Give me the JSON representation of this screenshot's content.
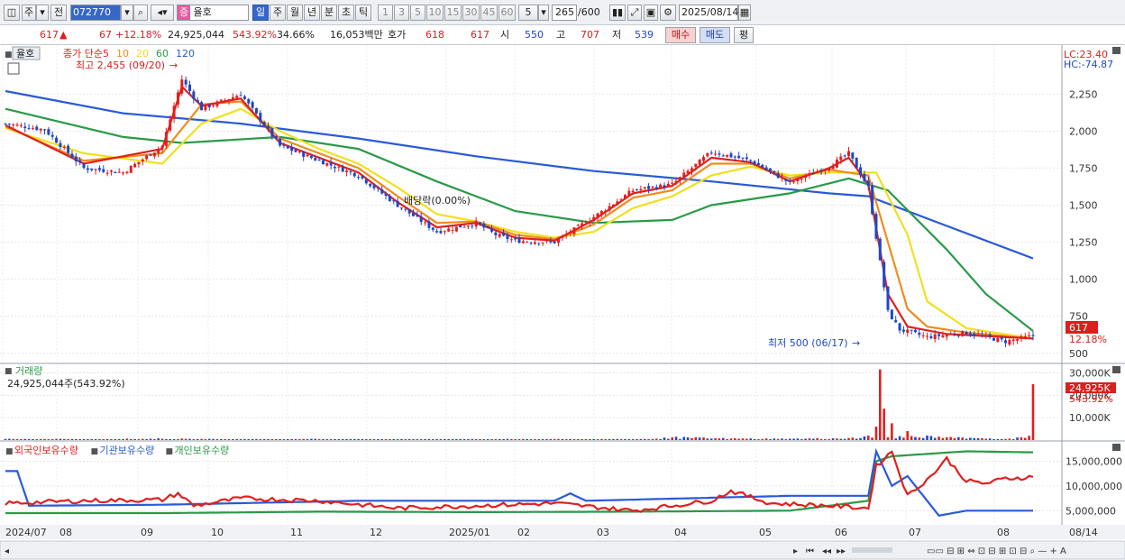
{
  "toolbar": {
    "prev_label": "주",
    "jeon_label": "전",
    "code_value": "072770",
    "name_badge": "증",
    "name_value": "율호",
    "periods": [
      "일",
      "주",
      "월",
      "년",
      "분",
      "초",
      "틱"
    ],
    "active_period": "일",
    "numbers": [
      "1",
      "3",
      "5",
      "10",
      "15",
      "30",
      "45",
      "60"
    ],
    "count_select": "5",
    "range_value": "265",
    "range_total": "/600",
    "date_value": "2025/08/14"
  },
  "quote": {
    "price": "617",
    "change_arrow": "▲",
    "change": "67",
    "change_pct": "+12.18%",
    "volume": "24,925,044",
    "volume_ratio": "543.92%",
    "turnover": "34.66%",
    "amount": "16,053백만",
    "hoga_label": "호가",
    "ask": "618",
    "bid": "617",
    "open_label": "시",
    "open": "550",
    "high_label": "고",
    "high": "707",
    "low_label": "저",
    "low": "539",
    "buy_label": "매수",
    "sell_label": "매도",
    "eval_label": "평"
  },
  "price_panel": {
    "name_tag": "율호",
    "legend_prefix": "종가 단순",
    "ma_periods": [
      "5",
      "10",
      "20",
      "60",
      "120"
    ],
    "ma_colors": [
      "#e0201e",
      "#f08c1e",
      "#f0e020",
      "#2a9a48",
      "#2a5ad8"
    ],
    "max_note": "최고 2,455 (09/20)",
    "min_note": "최저 500 (06/17)",
    "dividend_note": "배당락(0.00%)",
    "lc_label": "LC:23.40",
    "hc_label": "HC:-74.87",
    "last_price_tag": "617",
    "last_change_tag": "12.18%"
  },
  "volume_panel": {
    "title": "거래량",
    "value_text": "24,925,044주(543.92%)",
    "tag_value": "24,925K",
    "tag_pct": "543.92%"
  },
  "holding_panel": {
    "legend": [
      "외국인보유수량",
      "기관보유수량",
      "개인보유수량"
    ],
    "legend_colors": [
      "#e0201e",
      "#2a5ad8",
      "#2a9a48"
    ]
  },
  "chart_data": [
    {
      "type": "candlestick",
      "title": "",
      "x": [
        "2024/07",
        "08",
        "09",
        "10",
        "11",
        "12",
        "2025/01",
        "02",
        "03",
        "04",
        "05",
        "06",
        "07",
        "08"
      ],
      "y_ticks": [
        500,
        750,
        1000,
        1250,
        1500,
        1750,
        2000,
        2250
      ],
      "y_tick_labels": [
        "500",
        "750",
        "1,000",
        "1,250",
        "1,500",
        "1,750",
        "2,000",
        "2,250"
      ],
      "ylim": [
        450,
        2550
      ],
      "series": [
        {
          "name": "종가",
          "x": [
            0,
            10,
            20,
            30,
            40,
            45,
            50,
            60,
            70,
            80,
            90,
            100,
            110,
            120,
            125,
            130,
            140,
            150,
            160,
            170,
            180,
            190,
            200,
            210,
            215,
            220,
            225,
            228,
            235,
            245,
            255,
            262
          ],
          "values": [
            2050,
            2010,
            1750,
            1720,
            1900,
            2350,
            2150,
            2250,
            1900,
            1800,
            1700,
            1500,
            1320,
            1380,
            1300,
            1260,
            1250,
            1420,
            1600,
            1640,
            1860,
            1800,
            1650,
            1760,
            1850,
            1620,
            780,
            660,
            610,
            640,
            580,
            617
          ]
        },
        {
          "name": "5",
          "x": [
            0,
            20,
            40,
            45,
            50,
            60,
            70,
            80,
            90,
            100,
            110,
            120,
            130,
            140,
            150,
            160,
            170,
            180,
            190,
            200,
            210,
            215,
            220,
            225,
            230,
            240,
            262
          ],
          "values": [
            2040,
            1780,
            1880,
            2300,
            2170,
            2220,
            1920,
            1820,
            1720,
            1520,
            1350,
            1380,
            1280,
            1260,
            1400,
            1580,
            1630,
            1820,
            1790,
            1660,
            1750,
            1820,
            1640,
            900,
            680,
            630,
            600
          ]
        },
        {
          "name": "10",
          "x": [
            0,
            20,
            40,
            50,
            60,
            70,
            80,
            90,
            100,
            110,
            120,
            130,
            140,
            150,
            160,
            170,
            180,
            190,
            200,
            210,
            220,
            225,
            230,
            235,
            245,
            262
          ],
          "values": [
            2030,
            1800,
            1850,
            2180,
            2200,
            1950,
            1850,
            1750,
            1560,
            1380,
            1390,
            1300,
            1270,
            1370,
            1550,
            1600,
            1780,
            1780,
            1680,
            1740,
            1700,
            1250,
            800,
            680,
            640,
            600
          ]
        },
        {
          "name": "20",
          "x": [
            0,
            20,
            40,
            50,
            60,
            70,
            80,
            90,
            100,
            110,
            120,
            130,
            140,
            150,
            160,
            170,
            180,
            190,
            200,
            210,
            222,
            230,
            235,
            245,
            262
          ],
          "values": [
            2020,
            1850,
            1780,
            2050,
            2150,
            2000,
            1880,
            1780,
            1620,
            1440,
            1390,
            1320,
            1280,
            1320,
            1480,
            1560,
            1700,
            1760,
            1700,
            1720,
            1720,
            1300,
            850,
            670,
            600
          ]
        },
        {
          "name": "60",
          "x": [
            0,
            30,
            45,
            70,
            90,
            110,
            130,
            150,
            170,
            180,
            200,
            215,
            225,
            240,
            250,
            262
          ],
          "values": [
            2150,
            1960,
            1920,
            1960,
            1880,
            1660,
            1460,
            1380,
            1400,
            1500,
            1580,
            1680,
            1600,
            1200,
            900,
            650
          ]
        },
        {
          "name": "120",
          "x": [
            0,
            30,
            60,
            90,
            120,
            150,
            180,
            210,
            220,
            240,
            262
          ],
          "values": [
            2270,
            2120,
            2050,
            1950,
            1830,
            1730,
            1660,
            1580,
            1560,
            1360,
            1140
          ]
        }
      ]
    },
    {
      "type": "bar",
      "title": "",
      "y_tick_labels": [
        "10,000K",
        "20,000K",
        "30,000K"
      ],
      "ylim": [
        0,
        33000
      ],
      "x_index": [
        0,
        20,
        40,
        60,
        80,
        100,
        120,
        140,
        160,
        170,
        185,
        200,
        215,
        220,
        222,
        223,
        224,
        226,
        230,
        235,
        240,
        250,
        260,
        262
      ],
      "values": [
        500,
        400,
        600,
        350,
        450,
        300,
        400,
        500,
        350,
        1200,
        700,
        600,
        900,
        2000,
        6000,
        31500,
        14000,
        7500,
        4000,
        2000,
        1200,
        600,
        1000,
        24925
      ]
    },
    {
      "type": "line",
      "title": "",
      "y_tick_labels": [
        "5,000,000",
        "10,000,000",
        "15,000,000"
      ],
      "ylim": [
        2500000,
        18000000
      ],
      "series": [
        {
          "name": "외국인보유수량",
          "x": [
            0,
            20,
            40,
            44,
            48,
            60,
            80,
            100,
            120,
            140,
            160,
            180,
            185,
            195,
            210,
            220,
            222,
            226,
            230,
            236,
            240,
            245,
            250,
            255,
            262
          ],
          "values": [
            6500000,
            7000000,
            7200000,
            8500000,
            6000000,
            7500000,
            7000000,
            5500000,
            6000000,
            6500000,
            5000000,
            7000000,
            9000000,
            6500000,
            6000000,
            5500000,
            14000000,
            17000000,
            8000000,
            12000000,
            15500000,
            11000000,
            10500000,
            11500000,
            11800000
          ]
        },
        {
          "name": "기관보유수량",
          "x": [
            0,
            3,
            6,
            40,
            90,
            140,
            144,
            148,
            200,
            220,
            222,
            226,
            230,
            238,
            245,
            262
          ],
          "values": [
            13000000,
            13000000,
            6000000,
            6200000,
            7000000,
            7000000,
            8500000,
            7000000,
            8000000,
            8000000,
            17000000,
            10000000,
            12000000,
            4000000,
            5000000,
            5000000
          ]
        },
        {
          "name": "개인보유수량",
          "x": [
            0,
            40,
            80,
            120,
            160,
            200,
            220,
            222,
            226,
            245,
            262
          ],
          "values": [
            4500000,
            4500000,
            4800000,
            4700000,
            4800000,
            5000000,
            7000000,
            15000000,
            16000000,
            17000000,
            16800000
          ]
        }
      ]
    }
  ],
  "x_axis_labels": [
    "2024/07",
    "08",
    "09",
    "10",
    "11",
    "12",
    "2025/01",
    "02",
    "03",
    "04",
    "05",
    "06",
    "07",
    "08",
    "08/14"
  ]
}
